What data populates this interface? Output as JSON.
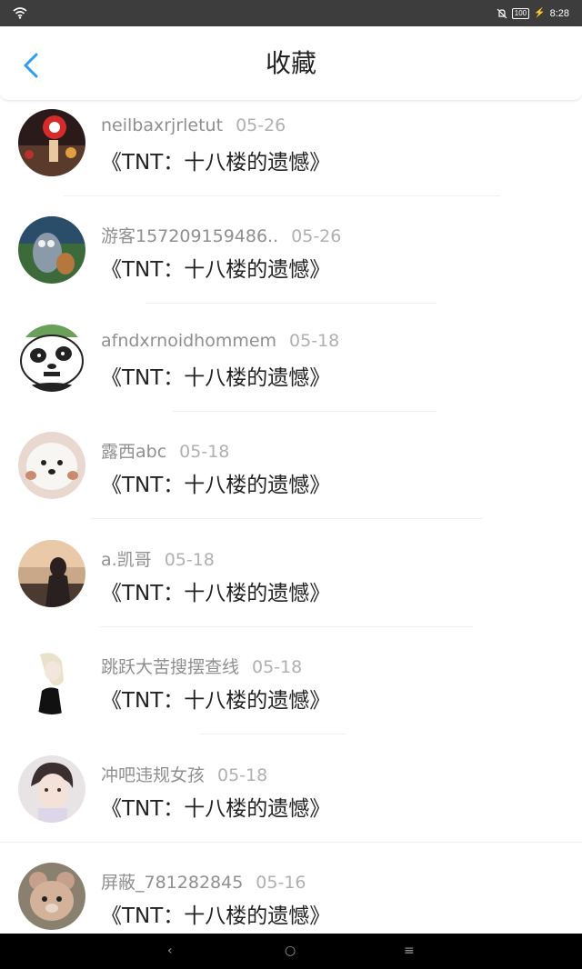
{
  "status_bar": {
    "battery": "100",
    "time": "8:28"
  },
  "header": {
    "title": "收藏"
  },
  "favorites": [
    {
      "user": "neilbaxrjrletut",
      "date": "05-26",
      "post": "《TNT：十八楼的遗憾》"
    },
    {
      "user": "游客157209159486..",
      "date": "05-26",
      "post": "《TNT：十八楼的遗憾》"
    },
    {
      "user": "afndxrnoidhommem",
      "date": "05-18",
      "post": "《TNT：十八楼的遗憾》"
    },
    {
      "user": "露西abc",
      "date": "05-18",
      "post": "《TNT：十八楼的遗憾》"
    },
    {
      "user": "a.凯哥",
      "date": "05-18",
      "post": "《TNT：十八楼的遗憾》"
    },
    {
      "user": "跳跃大苦搜摆查线",
      "date": "05-18",
      "post": "《TNT：十八楼的遗憾》"
    },
    {
      "user": "冲吧违规女孩",
      "date": "05-18",
      "post": "《TNT：十八楼的遗憾》"
    },
    {
      "user": "屏蔽_781282845",
      "date": "05-16",
      "post": "《TNT：十八楼的遗憾》"
    }
  ],
  "nav": {
    "back_glyph": "‹",
    "home_glyph": "○",
    "menu_glyph": "≡"
  },
  "colors": {
    "accent": "#2a9df4",
    "status_bar": "#3d3d3d",
    "nav_bar": "#000000"
  }
}
